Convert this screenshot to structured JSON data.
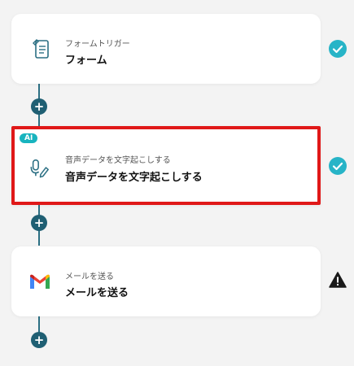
{
  "steps": [
    {
      "subtitle": "フォームトリガー",
      "title": "フォーム",
      "icon": "form-icon",
      "status": "check-icon"
    },
    {
      "subtitle": "音声データを文字起こしする",
      "title": "音声データを文字起こしする",
      "icon": "microphone-pen-icon",
      "status": "check-icon",
      "badge": "AI"
    },
    {
      "subtitle": "メールを送る",
      "title": "メールを送る",
      "icon": "gmail-icon",
      "status": "warning-icon"
    }
  ],
  "add_symbol": "+",
  "colors": {
    "accent": "#1f5f73",
    "check": "#27b4c7",
    "highlight": "#e01818",
    "ai_badge": "#18b4bf"
  }
}
